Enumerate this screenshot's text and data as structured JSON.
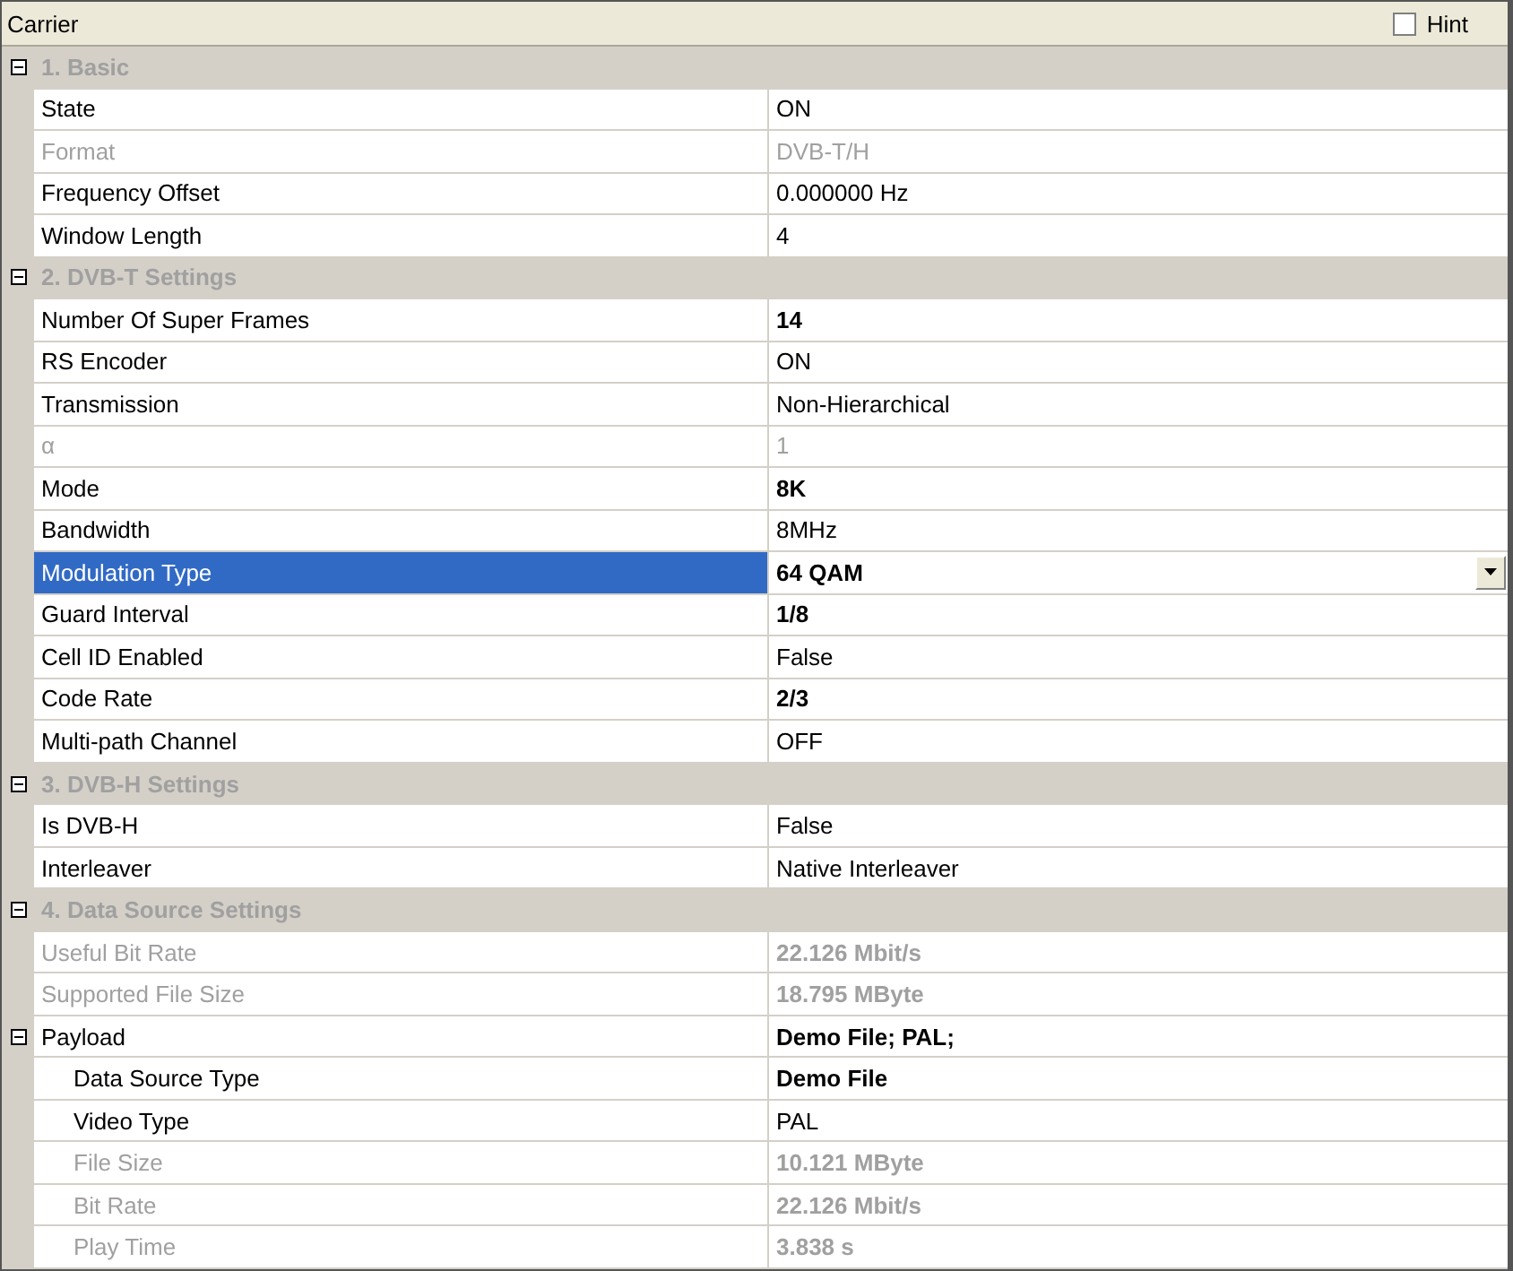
{
  "header": {
    "title": "Carrier",
    "hint": {
      "label": "Hint",
      "checked": false
    }
  },
  "groups": [
    {
      "title": "1. Basic",
      "expanded": true,
      "items": [
        {
          "name": "State",
          "value": "ON",
          "kind": "text",
          "disabled": false,
          "modified": false,
          "selected": false
        },
        {
          "name": "Format",
          "value": "DVB-T/H",
          "kind": "text",
          "disabled": true,
          "modified": false,
          "selected": false
        },
        {
          "name": "Frequency Offset",
          "value": "0.000000 Hz",
          "kind": "text",
          "disabled": false,
          "modified": false,
          "selected": false
        },
        {
          "name": "Window Length",
          "value": "4",
          "kind": "text",
          "disabled": false,
          "modified": false,
          "selected": false
        }
      ]
    },
    {
      "title": "2. DVB-T Settings",
      "expanded": true,
      "items": [
        {
          "name": "Number Of Super Frames",
          "value": "14",
          "kind": "text",
          "disabled": false,
          "modified": true,
          "selected": false
        },
        {
          "name": "RS Encoder",
          "value": "ON",
          "kind": "text",
          "disabled": false,
          "modified": false,
          "selected": false
        },
        {
          "name": "Transmission",
          "value": "Non-Hierarchical",
          "kind": "text",
          "disabled": false,
          "modified": false,
          "selected": false
        },
        {
          "name": "α",
          "value": "1",
          "kind": "text",
          "disabled": true,
          "modified": false,
          "selected": false
        },
        {
          "name": "Mode",
          "value": "8K",
          "kind": "text",
          "disabled": false,
          "modified": true,
          "selected": false
        },
        {
          "name": "Bandwidth",
          "value": "8MHz",
          "kind": "text",
          "disabled": false,
          "modified": false,
          "selected": false
        },
        {
          "name": "Modulation Type",
          "value": "64 QAM",
          "kind": "dropdown",
          "disabled": false,
          "modified": true,
          "selected": true
        },
        {
          "name": "Guard Interval",
          "value": "1/8",
          "kind": "text",
          "disabled": false,
          "modified": true,
          "selected": false
        },
        {
          "name": "Cell ID Enabled",
          "value": "False",
          "kind": "text",
          "disabled": false,
          "modified": false,
          "selected": false
        },
        {
          "name": "Code Rate",
          "value": "2/3",
          "kind": "text",
          "disabled": false,
          "modified": true,
          "selected": false
        },
        {
          "name": "Multi-path Channel",
          "value": "OFF",
          "kind": "text",
          "disabled": false,
          "modified": false,
          "selected": false
        }
      ]
    },
    {
      "title": "3. DVB-H Settings",
      "expanded": true,
      "items": [
        {
          "name": "Is DVB-H",
          "value": "False",
          "kind": "text",
          "disabled": false,
          "modified": false,
          "selected": false
        },
        {
          "name": "Interleaver",
          "value": "Native Interleaver",
          "kind": "text",
          "disabled": false,
          "modified": false,
          "selected": false
        }
      ]
    },
    {
      "title": "4. Data Source Settings",
      "expanded": true,
      "items": [
        {
          "name": "Useful Bit Rate",
          "value": "22.126 Mbit/s",
          "kind": "text",
          "disabled": true,
          "modified": true,
          "selected": false
        },
        {
          "name": "Supported File Size",
          "value": "18.795 MByte",
          "kind": "text",
          "disabled": true,
          "modified": true,
          "selected": false
        },
        {
          "name": "Payload",
          "value": "Demo File; PAL;",
          "kind": "text",
          "disabled": false,
          "modified": true,
          "selected": false,
          "expanded": true,
          "children": [
            {
              "name": "Data Source Type",
              "value": "Demo File",
              "kind": "text",
              "disabled": false,
              "modified": true,
              "selected": false
            },
            {
              "name": "Video Type",
              "value": "PAL",
              "kind": "text",
              "disabled": false,
              "modified": false,
              "selected": false
            },
            {
              "name": "File Size",
              "value": "10.121 MByte",
              "kind": "text",
              "disabled": true,
              "modified": true,
              "selected": false
            },
            {
              "name": "Bit Rate",
              "value": "22.126 Mbit/s",
              "kind": "text",
              "disabled": true,
              "modified": true,
              "selected": false
            },
            {
              "name": "Play Time",
              "value": "3.838 s",
              "kind": "text",
              "disabled": true,
              "modified": true,
              "selected": false
            }
          ]
        }
      ]
    }
  ]
}
